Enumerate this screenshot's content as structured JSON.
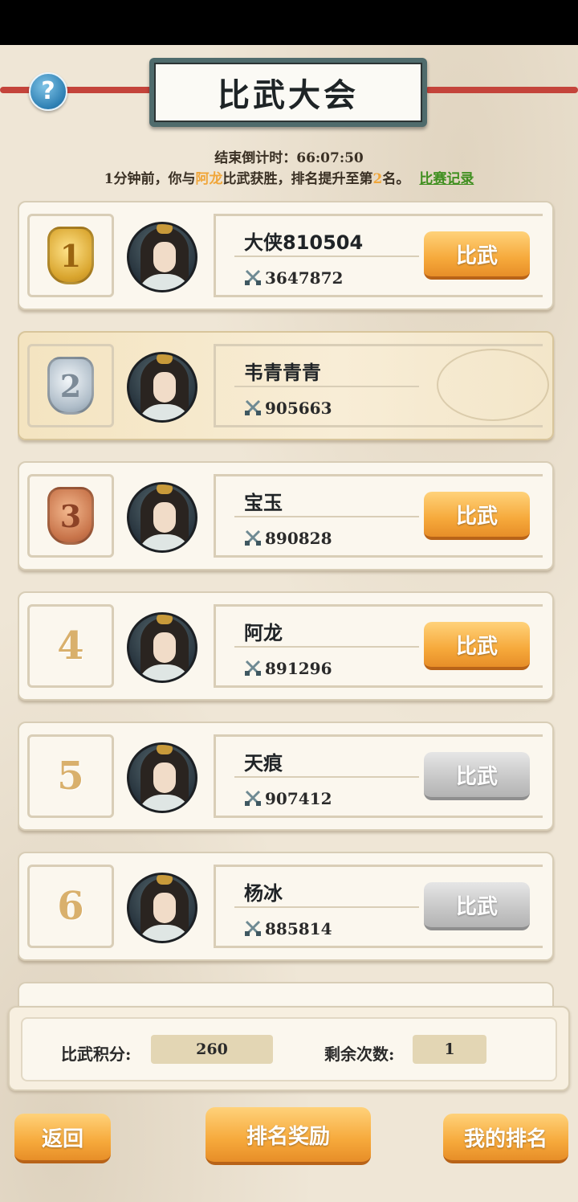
{
  "header": {
    "title": "比武大会",
    "help_label": "?"
  },
  "countdown": {
    "label": "结束倒计时：",
    "value": "66:07:50"
  },
  "battle_message": {
    "prefix": "1分钟前，你与",
    "opponent": "阿龙",
    "middle": "比武获胜，排名提升至第",
    "rank": "2",
    "suffix": "名。",
    "record_link": "比赛记录"
  },
  "ranking": [
    {
      "rank": "1",
      "medal": "gold",
      "name": "大侠810504",
      "power": "3647872",
      "button": "比武",
      "button_state": "active"
    },
    {
      "rank": "2",
      "medal": "silver",
      "name": "韦青青青",
      "power": "905663",
      "button": "",
      "button_state": "self"
    },
    {
      "rank": "3",
      "medal": "bronze",
      "name": "宝玉",
      "power": "890828",
      "button": "比武",
      "button_state": "active"
    },
    {
      "rank": "4",
      "medal": "none",
      "name": "阿龙",
      "power": "891296",
      "button": "比武",
      "button_state": "active"
    },
    {
      "rank": "5",
      "medal": "none",
      "name": "天痕",
      "power": "907412",
      "button": "比武",
      "button_state": "disabled"
    },
    {
      "rank": "6",
      "medal": "none",
      "name": "杨冰",
      "power": "885814",
      "button": "比武",
      "button_state": "disabled"
    }
  ],
  "score_panel": {
    "points_label": "比武积分:",
    "points_value": "260",
    "remaining_label": "剩余次数:",
    "remaining_value": "1"
  },
  "bottom_buttons": {
    "back": "返回",
    "rank_reward": "排名奖励",
    "my_rank": "我的排名"
  },
  "colors": {
    "highlight": "#f0a63a",
    "link": "#3f8f1f",
    "button_active": "#f6a93b",
    "button_disabled": "#c6c6c6"
  }
}
